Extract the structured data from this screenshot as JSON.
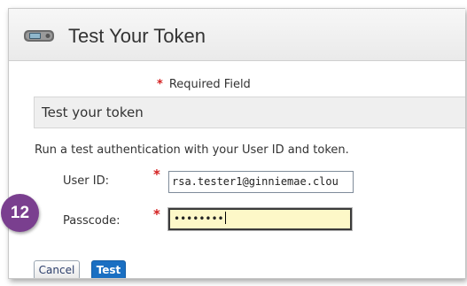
{
  "window": {
    "title": "Test Your Token",
    "icon": "token-icon"
  },
  "required_note": {
    "marker": "*",
    "text": "Required Field"
  },
  "section": {
    "title": "Test your token",
    "description": "Run a test authentication with your User ID and token."
  },
  "form": {
    "user_id": {
      "label": "User ID:",
      "required_marker": "*",
      "value": "rsa.tester1@ginniemae.clou"
    },
    "passcode": {
      "label": "Passcode:",
      "required_marker": "*",
      "value": "••••••••"
    }
  },
  "step_badge": "12",
  "buttons": {
    "cancel": "Cancel",
    "test": "Test"
  },
  "colors": {
    "required": "#d42020",
    "primary_button": "#1a6fc2",
    "badge": "#7a3f8f",
    "active_input": "#fdf8c8"
  }
}
